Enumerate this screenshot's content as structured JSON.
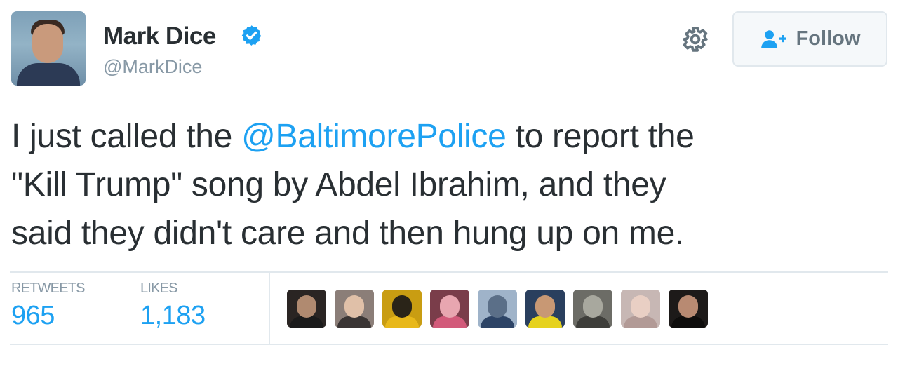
{
  "user": {
    "name": "Mark Dice",
    "handle": "@MarkDice",
    "verified": true,
    "avatar_icon": "profile-photo"
  },
  "actions": {
    "settings_icon": "gear-icon",
    "follow_label": "Follow",
    "follow_icon": "add-user-icon"
  },
  "tweet": {
    "lines": [
      {
        "before": "I just called the ",
        "mention": "@BaltimorePolice",
        "after": " to report the"
      },
      {
        "text": "\"Kill Trump\" song by Abdel Ibrahim, and they"
      },
      {
        "text": "said they didn't care and then hung up on me."
      }
    ]
  },
  "stats": {
    "retweets_label": "RETWEETS",
    "retweets_value": "965",
    "likes_label": "LIKES",
    "likes_value": "1,183"
  },
  "likers": [
    {
      "bg": "#2a2523",
      "head": "#b08a70",
      "body": "#1b1b1b"
    },
    {
      "bg": "#8b7e78",
      "head": "#e0c0a8",
      "body": "#3a3534"
    },
    {
      "bg": "#c99d12",
      "head": "#2a2418",
      "body": "#e8b81a"
    },
    {
      "bg": "#7a3d4a",
      "head": "#e8a6b0",
      "body": "#d25a7a"
    },
    {
      "bg": "#9fb3c9",
      "head": "#5b6f88",
      "body": "#2d4466"
    },
    {
      "bg": "#2a3f5e",
      "head": "#c89874",
      "body": "#e6d21e"
    },
    {
      "bg": "#6c6c66",
      "head": "#a8a89e",
      "body": "#3e3e3a"
    },
    {
      "bg": "#c7b7b4",
      "head": "#e9cfc4",
      "body": "#b29a96"
    },
    {
      "bg": "#1d1a19",
      "head": "#b88a72",
      "body": "#0e0d0c"
    }
  ],
  "colors": {
    "accent": "#1da1f2",
    "text": "#292f33",
    "muted": "#8899a6",
    "border": "#e1e8ed"
  }
}
